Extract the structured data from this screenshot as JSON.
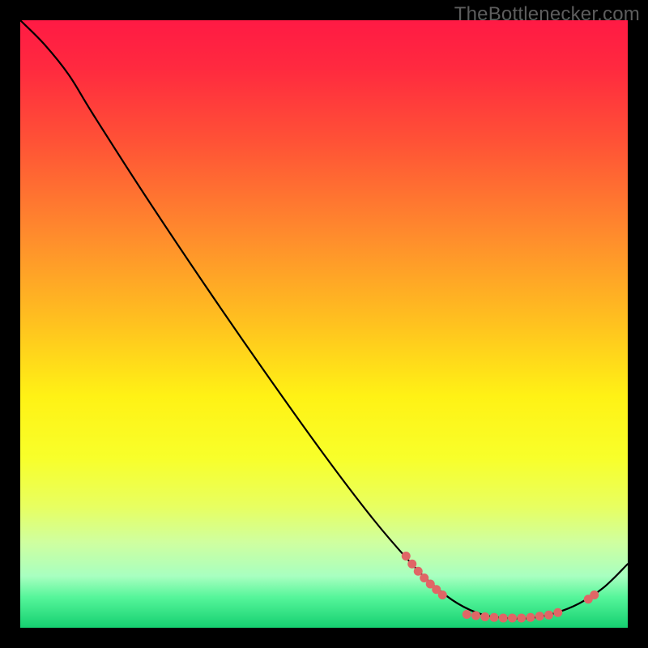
{
  "watermark": "TheBottlenecker.com",
  "chart_data": {
    "type": "line",
    "title": "",
    "xlabel": "",
    "ylabel": "",
    "xlim": [
      0,
      100
    ],
    "ylim": [
      0,
      100
    ],
    "grid": false,
    "background_gradient": {
      "stops": [
        {
          "offset": 0.0,
          "color": "#ff1a44"
        },
        {
          "offset": 0.08,
          "color": "#ff2a3f"
        },
        {
          "offset": 0.2,
          "color": "#ff5236"
        },
        {
          "offset": 0.35,
          "color": "#ff8a2d"
        },
        {
          "offset": 0.5,
          "color": "#ffc21f"
        },
        {
          "offset": 0.62,
          "color": "#fff215"
        },
        {
          "offset": 0.72,
          "color": "#f8ff2a"
        },
        {
          "offset": 0.8,
          "color": "#e8ff60"
        },
        {
          "offset": 0.86,
          "color": "#cfffa0"
        },
        {
          "offset": 0.915,
          "color": "#a8ffc0"
        },
        {
          "offset": 0.95,
          "color": "#55f59a"
        },
        {
          "offset": 1.0,
          "color": "#15d070"
        }
      ]
    },
    "series": [
      {
        "name": "curve",
        "kind": "spline",
        "draw_dots": false,
        "stroke": "#000000",
        "stroke_width": 2.2,
        "points": [
          {
            "x": 0.0,
            "y": 100.0
          },
          {
            "x": 4.0,
            "y": 96.0
          },
          {
            "x": 8.0,
            "y": 91.0
          },
          {
            "x": 12.0,
            "y": 84.5
          },
          {
            "x": 20.0,
            "y": 72.0
          },
          {
            "x": 30.0,
            "y": 57.0
          },
          {
            "x": 40.0,
            "y": 42.5
          },
          {
            "x": 50.0,
            "y": 28.5
          },
          {
            "x": 58.0,
            "y": 18.0
          },
          {
            "x": 64.0,
            "y": 11.0
          },
          {
            "x": 68.0,
            "y": 7.0
          },
          {
            "x": 72.0,
            "y": 4.0
          },
          {
            "x": 76.0,
            "y": 2.2
          },
          {
            "x": 80.0,
            "y": 1.6
          },
          {
            "x": 84.0,
            "y": 1.6
          },
          {
            "x": 88.0,
            "y": 2.4
          },
          {
            "x": 92.0,
            "y": 4.0
          },
          {
            "x": 96.0,
            "y": 6.6
          },
          {
            "x": 100.0,
            "y": 10.5
          }
        ]
      },
      {
        "name": "marker-dots",
        "kind": "scatter",
        "radius": 5.5,
        "fill": "#e06666",
        "points": [
          {
            "x": 63.5,
            "y": 11.8
          },
          {
            "x": 64.5,
            "y": 10.5
          },
          {
            "x": 65.5,
            "y": 9.3
          },
          {
            "x": 66.5,
            "y": 8.2
          },
          {
            "x": 67.5,
            "y": 7.2
          },
          {
            "x": 68.5,
            "y": 6.3
          },
          {
            "x": 69.5,
            "y": 5.4
          },
          {
            "x": 73.5,
            "y": 2.2
          },
          {
            "x": 75.0,
            "y": 2.0
          },
          {
            "x": 76.5,
            "y": 1.8
          },
          {
            "x": 78.0,
            "y": 1.7
          },
          {
            "x": 79.5,
            "y": 1.6
          },
          {
            "x": 81.0,
            "y": 1.6
          },
          {
            "x": 82.5,
            "y": 1.6
          },
          {
            "x": 84.0,
            "y": 1.7
          },
          {
            "x": 85.5,
            "y": 1.9
          },
          {
            "x": 87.0,
            "y": 2.1
          },
          {
            "x": 88.5,
            "y": 2.5
          },
          {
            "x": 93.5,
            "y": 4.7
          },
          {
            "x": 94.5,
            "y": 5.4
          }
        ]
      }
    ]
  }
}
